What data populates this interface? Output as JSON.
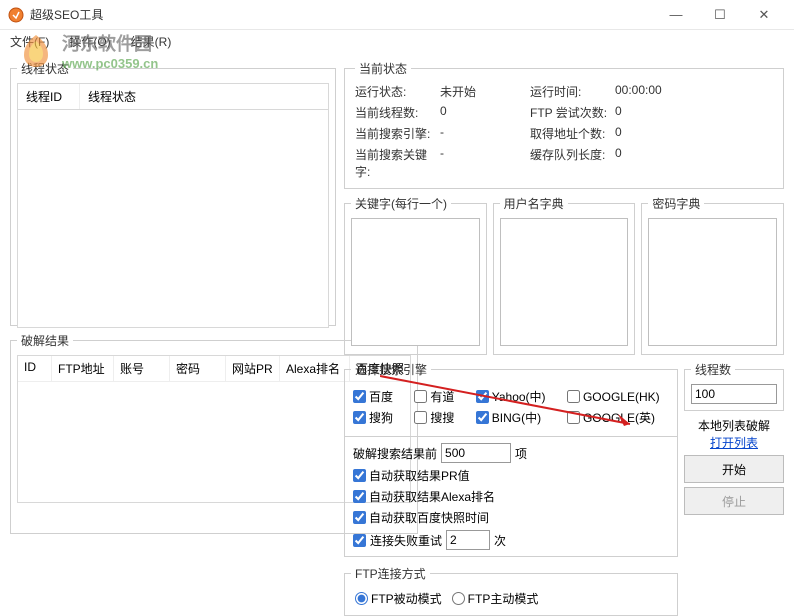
{
  "window": {
    "title": "超级SEO工具"
  },
  "menu": {
    "file": "文件(F)",
    "operate": "操作(O)",
    "result": "结果(R)"
  },
  "watermark": {
    "name": "河东软件园",
    "url": "www.pc0359.cn"
  },
  "threadBox": {
    "legend": "线程状态",
    "colId": "线程ID",
    "colStatus": "线程状态"
  },
  "crackBox": {
    "legend": "破解结果",
    "cols": {
      "id": "ID",
      "ftp": "FTP地址",
      "account": "账号",
      "pwd": "密码",
      "pr": "网站PR",
      "alexa": "Alexa排名",
      "snapshot": "百度快照"
    }
  },
  "statusBox": {
    "legend": "当前状态",
    "rows": {
      "runStatus": "运行状态:",
      "runStatusVal": "未开始",
      "runTime": "运行时间:",
      "runTimeVal": "00:00:00",
      "threads": "当前线程数:",
      "threadsVal": "0",
      "ftpTries": "FTP 尝试次数:",
      "ftpTriesVal": "0",
      "engine": "当前搜索引擎:",
      "engineVal": "-",
      "addrGot": "取得地址个数:",
      "addrGotVal": "0",
      "keyword": "当前搜索关键字:",
      "keywordVal": "-",
      "queueLen": "缓存队列长度:",
      "queueLenVal": "0"
    }
  },
  "dicts": {
    "keyword": "关键字(每行一个)",
    "user": "用户名字典",
    "pwd": "密码字典"
  },
  "engines": {
    "legend": "选择搜索引擎",
    "baidu": "百度",
    "youdao": "有道",
    "yahooCn": "Yahoo(中)",
    "googleHk": "GOOGLE(HK)",
    "sogou": "搜狗",
    "soso": "搜搜",
    "bingCn": "BING(中)",
    "googleEn": "GOOGLE(英)"
  },
  "opts": {
    "crackTopPre": "破解搜索结果前",
    "crackTopVal": "500",
    "crackTopSuf": "项",
    "autoPR": "自动获取结果PR值",
    "autoAlexa": "自动获取结果Alexa排名",
    "autoSnapshot": "自动获取百度快照时间",
    "retryPre": "连接失败重试",
    "retryVal": "2",
    "retrySuf": "次"
  },
  "ftp": {
    "legend": "FTP连接方式",
    "passive": "FTP被动模式",
    "active": "FTP主动模式"
  },
  "side": {
    "threadsLegend": "线程数",
    "threadsVal": "100",
    "localList": "本地列表破解",
    "openList": "打开列表",
    "start": "开始",
    "stop": "停止"
  }
}
